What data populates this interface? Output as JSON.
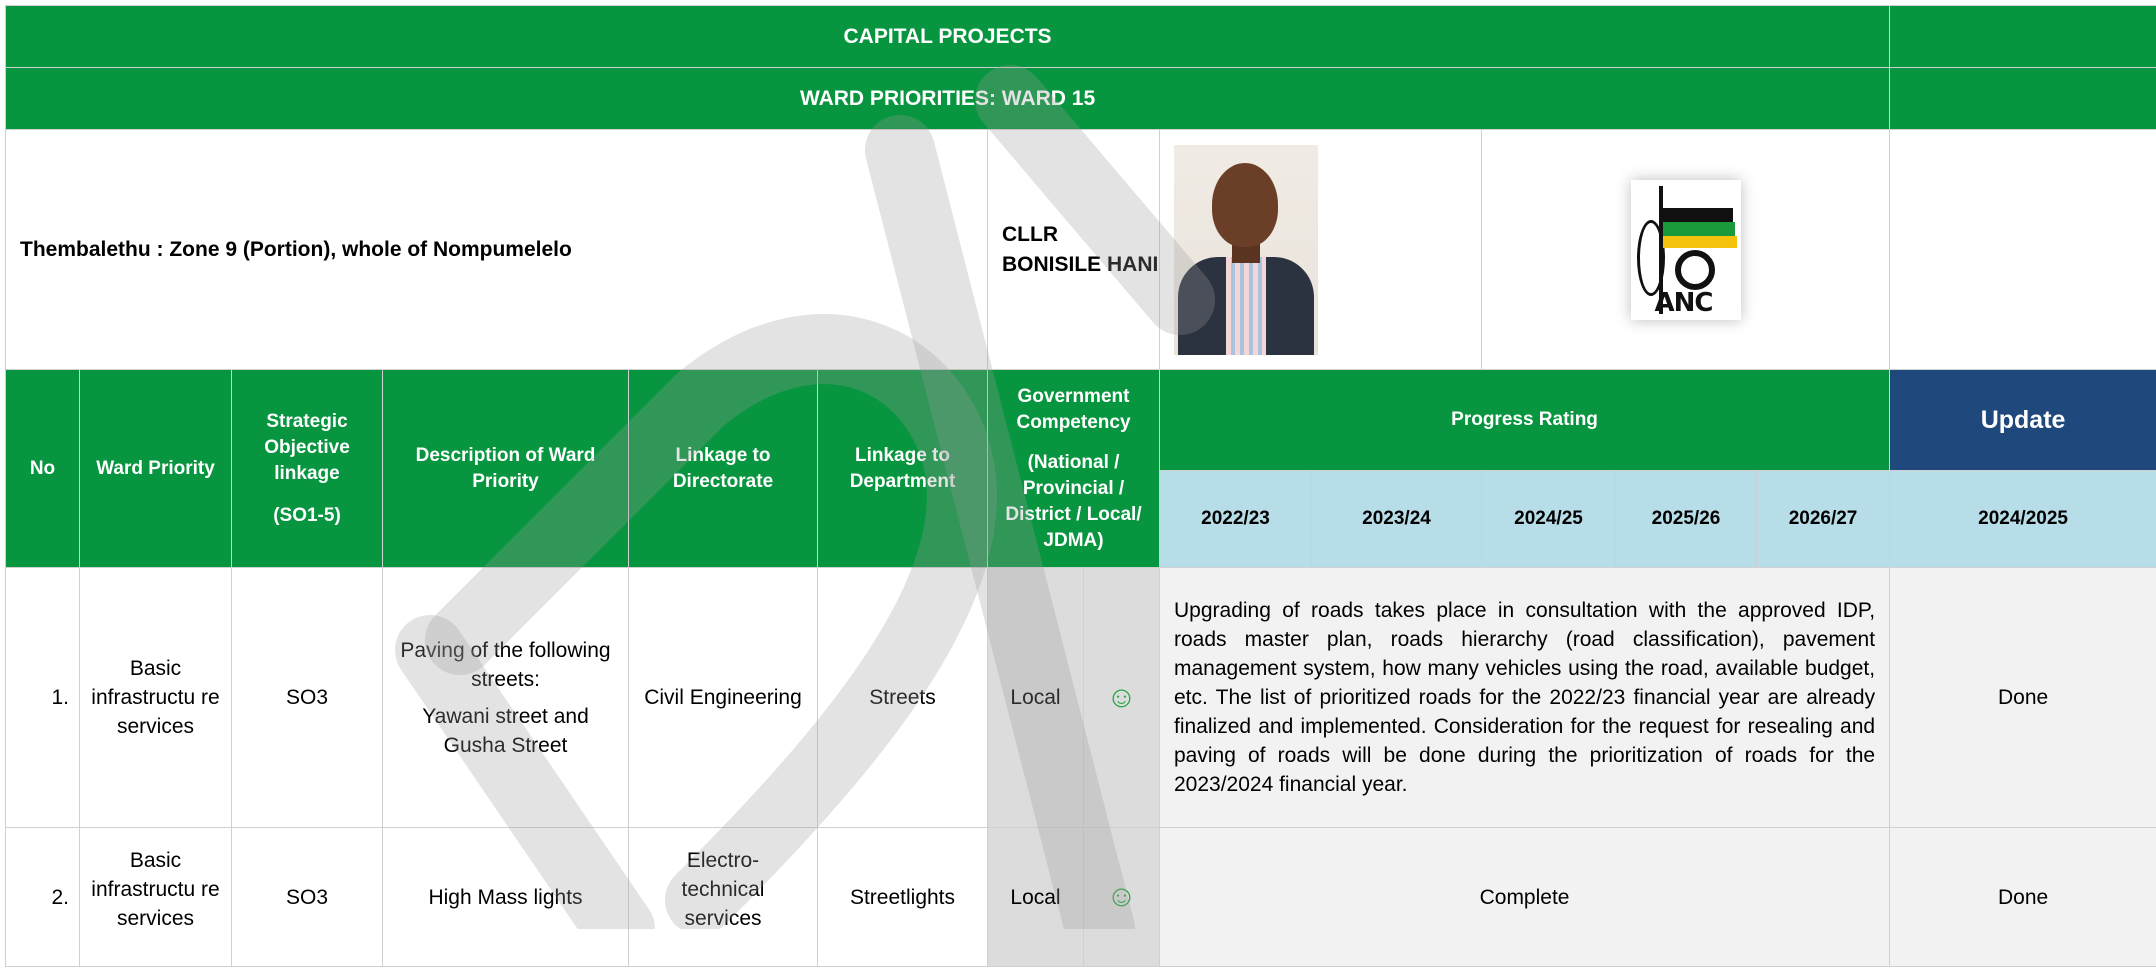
{
  "banner": {
    "title": "CAPITAL PROJECTS",
    "subtitle": "WARD PRIORITIES: WARD 15"
  },
  "ward_info": {
    "area": "Thembalethu : Zone 9 (Portion), whole of Nompumelelo",
    "councillor": "CLLR BONISILE HANI",
    "party_logo_text": "ANC",
    "photo_icon": "councillor-photo",
    "logo_icon": "anc-logo"
  },
  "headers": {
    "no": "No",
    "ward_priority": "Ward Priority",
    "strategic_1": "Strategic Objective linkage",
    "strategic_2": "(SO1-5)",
    "description": "Description of Ward Priority",
    "directorate": "Linkage to Directorate",
    "department": "Linkage to Department",
    "gov_1": "Government Competency",
    "gov_2": "(National / Provincial / District / Local/ JDMA)",
    "progress": "Progress Rating",
    "update": "Update",
    "years": [
      "2022/23",
      "2023/24",
      "2024/25",
      "2025/26",
      "2026/27"
    ],
    "update_year": "2024/2025"
  },
  "rows": [
    {
      "no": "1.",
      "ward_priority": "Basic infrastructu re services",
      "strategic": "SO3",
      "description_1": "Paving of the following streets:",
      "description_2": "Yawani street and Gusha Street",
      "directorate": "Civil Engineering",
      "department": "Streets",
      "competency": "Local",
      "rating_icon": "smiley-icon",
      "rating_glyph": "☺",
      "progress": "Upgrading of roads takes place in consultation with the approved IDP, roads master plan, roads hierarchy (road classification), pavement management system, how many vehicles using the road, available budget, etc. The list of prioritized roads for the 2022/23 financial year are already finalized and implemented. Consideration for the request for resealing and paving of roads will be done during the prioritization of roads for the 2023/2024 financial year.",
      "update": "Done"
    },
    {
      "no": "2.",
      "ward_priority": "Basic infrastructu re services",
      "strategic": "SO3",
      "description_1": "High Mass lights",
      "directorate": "Electro- technical services",
      "department": "Streetlights",
      "competency": "Local",
      "rating_icon": "smiley-icon",
      "rating_glyph": "☺",
      "progress": "Complete",
      "update": "Done"
    }
  ],
  "colors": {
    "header_green": "#07963f",
    "year_band": "#b7dde8",
    "update_blue": "#1f497d",
    "smiley_green": "#2aa845"
  }
}
